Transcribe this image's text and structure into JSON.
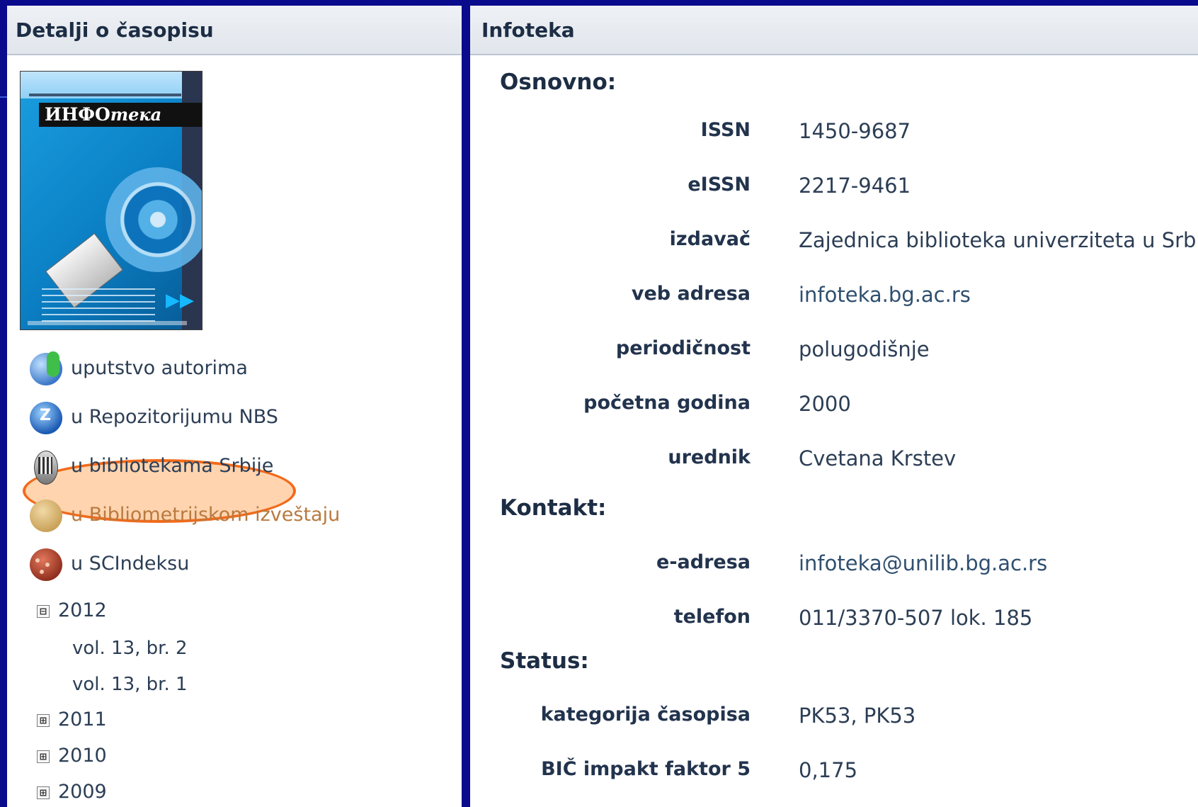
{
  "left": {
    "header": "Detalji o časopisu",
    "cover": {
      "title_main": "ИНФО",
      "title_italic": "тека"
    },
    "links": [
      {
        "label": "uputstvo autorima",
        "icon": "users-icon"
      },
      {
        "label": "u Repozitorijumu NBS",
        "icon": "repository-icon"
      },
      {
        "label": "u bibliotekama Srbije",
        "icon": "library-icon"
      },
      {
        "label": "u Bibliometrijskom izveštaju",
        "icon": "bibliometric-icon",
        "highlighted": true
      },
      {
        "label": "u SCIndeksu",
        "icon": "scindeks-icon"
      }
    ],
    "tree": {
      "years": [
        {
          "year": "2012",
          "toggle": "⊟",
          "issues": [
            "vol. 13, br. 2",
            "vol. 13, br. 1"
          ]
        },
        {
          "year": "2011",
          "toggle": "⊞"
        },
        {
          "year": "2010",
          "toggle": "⊞"
        },
        {
          "year": "2009",
          "toggle": "⊞"
        }
      ]
    }
  },
  "right": {
    "header": "Infoteka",
    "sections": {
      "osnovno": {
        "title": "Osnovno:",
        "rows": [
          {
            "key": "ISSN",
            "value": "1450-9687"
          },
          {
            "key": "eISSN",
            "value": "2217-9461"
          },
          {
            "key": "izdavač",
            "value": "Zajednica biblioteka univerziteta u Srbiji"
          },
          {
            "key": "veb adresa",
            "value": "infoteka.bg.ac.rs"
          },
          {
            "key": "periodičnost",
            "value": "polugodišnje"
          },
          {
            "key": "početna godina",
            "value": "2000"
          },
          {
            "key": "urednik",
            "value": "Cvetana Krstev"
          }
        ]
      },
      "kontakt": {
        "title": "Kontakt:",
        "rows": [
          {
            "key": "e-adresa",
            "value": "infoteka@unilib.bg.ac.rs"
          },
          {
            "key": "telefon",
            "value": "011/3370-507 lok. 185"
          }
        ]
      },
      "status": {
        "title": "Status:",
        "rows": [
          {
            "key": "kategorija časopisa",
            "value": "PK53, PK53"
          },
          {
            "key": "BIČ impakt faktor 5",
            "value": "0,175"
          }
        ]
      }
    }
  },
  "colors": {
    "background": "#0a0a8c",
    "highlight_ring": "#f26a1a",
    "text": "#2c3e55"
  }
}
